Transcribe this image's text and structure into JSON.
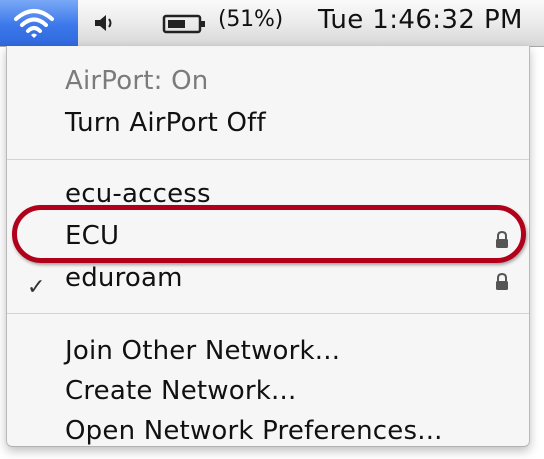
{
  "menubar": {
    "wifi_icon": "wifi-icon",
    "volume_icon": "speaker-icon",
    "battery_icon": "battery-icon",
    "battery_percent": "(51%)",
    "clock": "Tue 1:46:32 PM"
  },
  "menu": {
    "status": "AirPort: On",
    "toggle": "Turn AirPort Off",
    "networks": [
      {
        "name": "ecu-access",
        "checked": false,
        "locked": false
      },
      {
        "name": "ECU",
        "checked": true,
        "locked": true
      },
      {
        "name": "eduroam",
        "checked": false,
        "locked": true
      }
    ],
    "check_glyph": "✓",
    "actions": {
      "join_other": "Join Other Network...",
      "create": "Create Network...",
      "preferences": "Open Network Preferences..."
    }
  },
  "annotation": {
    "color": "#b0001a"
  }
}
